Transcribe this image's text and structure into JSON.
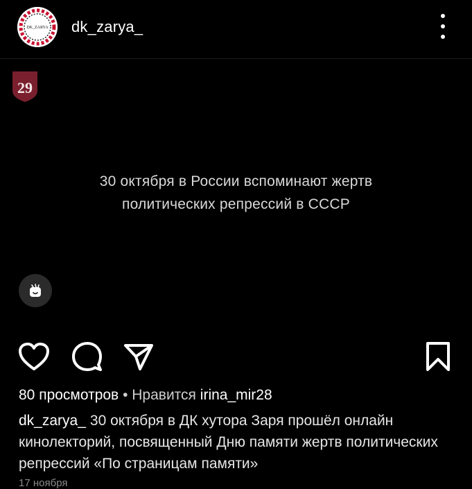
{
  "header": {
    "avatar_text": "DK_ZARYA",
    "username": "dk_zarya_"
  },
  "media": {
    "badge_number": "29",
    "text_line_1": "30 октября в России вспоминают жертв",
    "text_line_2": "политических репрессий в СССР"
  },
  "stats": {
    "views": "80 просмотров",
    "separator": "•",
    "liked_by_prefix": "Нравится",
    "liked_by_user": "irina_mir28"
  },
  "caption": {
    "author": "dk_zarya_",
    "text": "30 октября в ДК хутора Заря прошёл онлайн кинолекторий, посвященный Дню памяти жертв политических репрессий «По страницам памяти»"
  },
  "date": "17 ноября",
  "colors": {
    "background": "#000000",
    "badge": "#7a1f2e",
    "reel_button": "#2b2b2b"
  }
}
